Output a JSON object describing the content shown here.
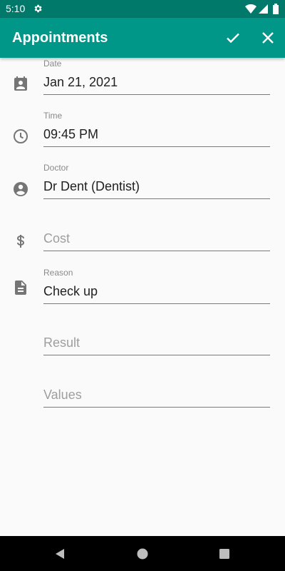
{
  "status_bar": {
    "time": "5:10"
  },
  "app_bar": {
    "title": "Appointments"
  },
  "form": {
    "date": {
      "label": "Date",
      "value": "Jan 21, 2021"
    },
    "time": {
      "label": "Time",
      "value": "09:45 PM"
    },
    "doctor": {
      "label": "Doctor",
      "value": "Dr Dent (Dentist)"
    },
    "cost": {
      "placeholder": "Cost"
    },
    "reason": {
      "label": "Reason",
      "value": "Check up"
    },
    "result": {
      "placeholder": "Result"
    },
    "values": {
      "placeholder": "Values"
    }
  },
  "colors": {
    "primary": "#009688",
    "primary_dark": "#00796b",
    "icon_gray": "#757575"
  },
  "icons": [
    "settings-icon",
    "wifi-icon",
    "signal-icon",
    "battery-icon",
    "check-icon",
    "close-icon",
    "calendar-icon",
    "clock-icon",
    "account-icon",
    "dollar-icon",
    "document-icon",
    "back-icon",
    "home-icon",
    "recents-icon"
  ]
}
